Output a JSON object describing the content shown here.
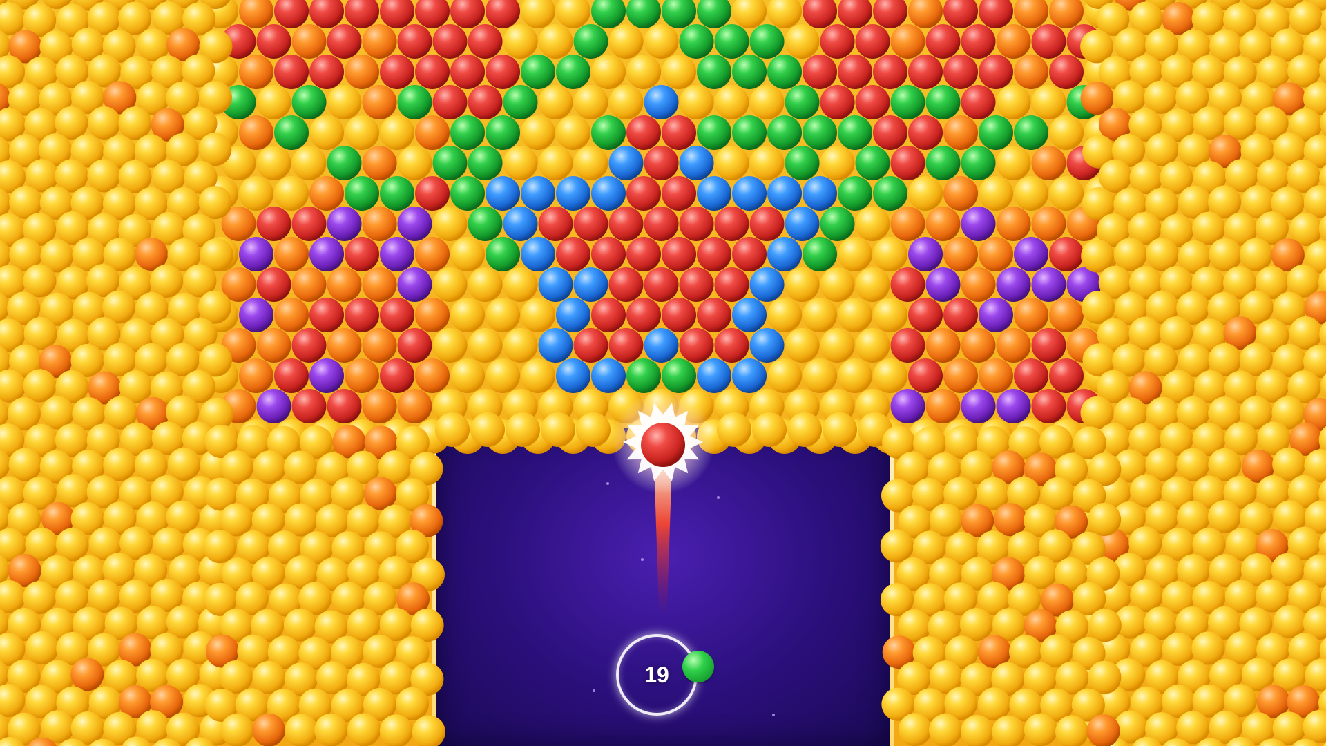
{
  "game": {
    "moves_remaining": "19",
    "next_bubble_color": "green",
    "shooter_bubble_color": "red"
  },
  "palette": {
    "yellow": "#f7c51c",
    "orange": "#f2821c",
    "red": "#e23a36",
    "green": "#22b83c",
    "blue": "#2b86f0",
    "purple": "#8a35d8",
    "playfield": "#2a0f7a"
  },
  "icons": {
    "shooter": "red-bubble-with-starburst-icon",
    "next": "green-bubble-icon",
    "counter": "moves-ring-icon"
  }
}
